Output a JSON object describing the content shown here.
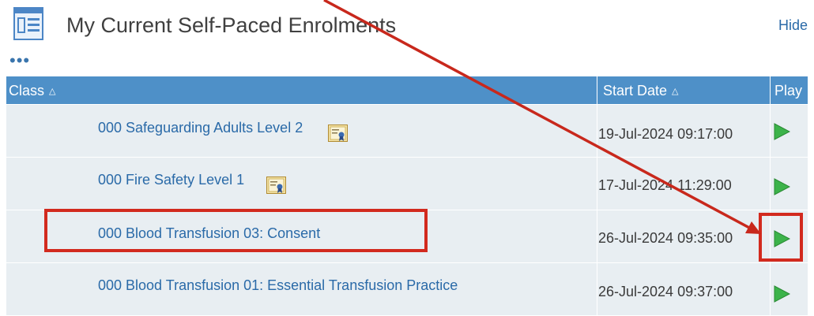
{
  "header": {
    "title": "My Current Self-Paced Enrolments",
    "hide_label": "Hide"
  },
  "toolbar": {
    "more_label": "•••"
  },
  "table": {
    "columns": {
      "class": "Class",
      "start_date": "Start Date",
      "play": "Play"
    },
    "rows": [
      {
        "name": "000 Safeguarding Adults Level 2",
        "start_date": "19-Jul-2024 09:17:00",
        "has_certificate": true
      },
      {
        "name": "000 Fire Safety Level 1",
        "start_date": "17-Jul-2024 11:29:00",
        "has_certificate": true
      },
      {
        "name": "000 Blood Transfusion 03: Consent",
        "start_date": "26-Jul-2024 09:35:00",
        "has_certificate": false,
        "highlighted": true
      },
      {
        "name": "000 Blood Transfusion 01: Essential Transfusion Practice",
        "start_date": "26-Jul-2024 09:37:00",
        "has_certificate": false
      }
    ]
  },
  "colors": {
    "header_bar": "#4e90c8",
    "row_bg": "#e8eef2",
    "link": "#2a6aa8",
    "play": "#3cb34a",
    "annotation": "#d22a1e"
  },
  "icons": {
    "header": "list-icon",
    "certificate": "certificate-icon",
    "play": "play-icon"
  }
}
